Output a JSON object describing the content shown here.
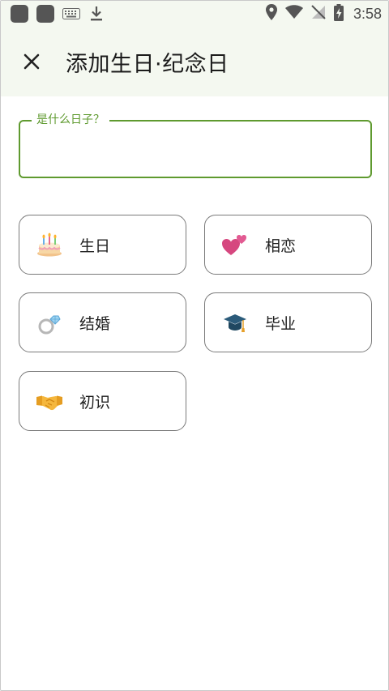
{
  "status_bar": {
    "time": "3:58",
    "icons": [
      "app-square-icon",
      "app-square-icon",
      "keyboard-icon",
      "download-icon",
      "location-icon",
      "wifi-icon",
      "no-signal-icon",
      "battery-charging-icon"
    ]
  },
  "app_bar": {
    "close_icon": "close-icon",
    "title": "添加生日·纪念日"
  },
  "field": {
    "label": "是什么日子？",
    "value": ""
  },
  "options": [
    {
      "label": "生日",
      "icon": "birthday-cake-icon"
    },
    {
      "label": "相恋",
      "icon": "two-hearts-icon"
    },
    {
      "label": "结婚",
      "icon": "ring-icon"
    },
    {
      "label": "毕业",
      "icon": "graduation-cap-icon"
    },
    {
      "label": "初识",
      "icon": "handshake-icon"
    }
  ],
  "colors": {
    "accent": "#5f9a2f",
    "header_bg": "#f4f8f0",
    "card_border": "#7a7a7a"
  }
}
